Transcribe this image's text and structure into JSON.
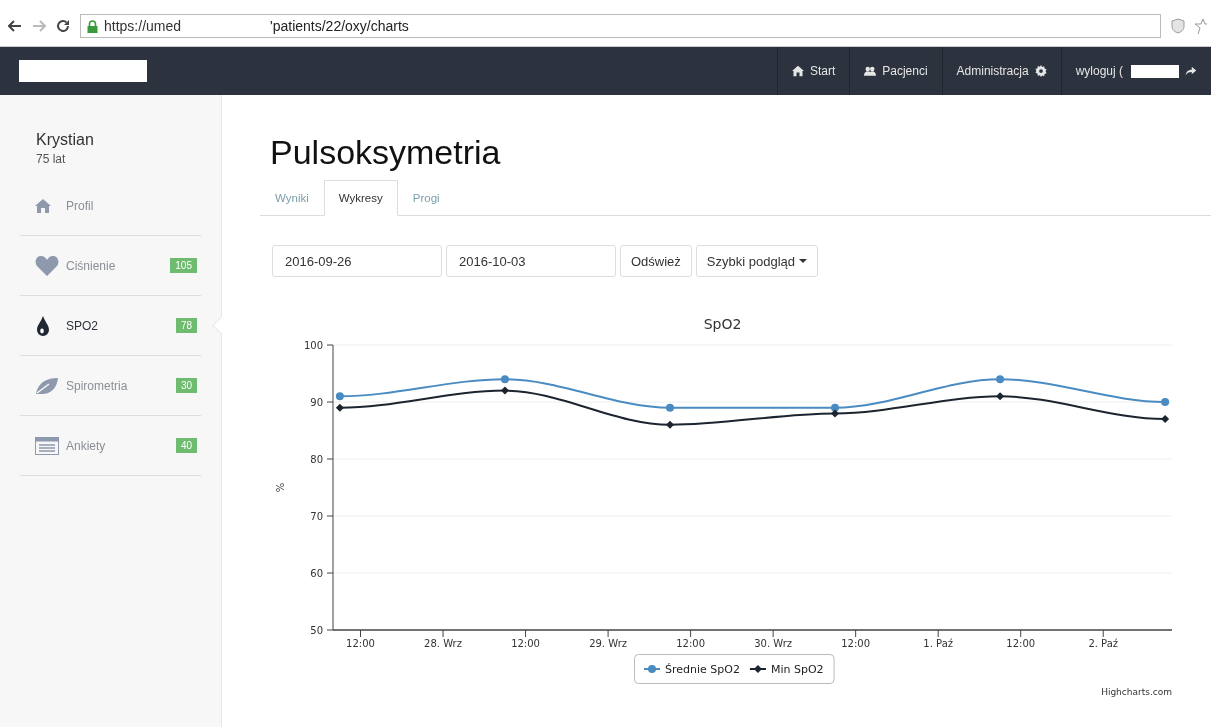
{
  "browser": {
    "url_parts": [
      "https://umed",
      "'patients/22/oxy/charts"
    ]
  },
  "navbar": {
    "items": [
      {
        "label": "Start"
      },
      {
        "label": "Pacjenci"
      },
      {
        "label": "Administracja"
      },
      {
        "label": "wyloguj ("
      }
    ]
  },
  "sidebar": {
    "patient_name": "Krystian",
    "age": "75 lat",
    "items": [
      {
        "label": "Profil",
        "selected": false
      },
      {
        "label": "Ciśnienie",
        "badge": "105",
        "selected": false
      },
      {
        "label": "SPO2",
        "badge": "78",
        "selected": true
      },
      {
        "label": "Spirometria",
        "badge": "30",
        "selected": false
      },
      {
        "label": "Ankiety",
        "badge": "40",
        "selected": false
      }
    ]
  },
  "page": {
    "title": "Pulsoksymetria",
    "tabs": [
      {
        "label": "Wyniki",
        "selected": false
      },
      {
        "label": "Wykresy",
        "selected": true
      },
      {
        "label": "Progi",
        "selected": false
      }
    ],
    "date_from": "2016-09-26",
    "date_to": "2016-10-03",
    "refresh_button": "Odśwież",
    "quick_view_button": "Szybki podgląd"
  },
  "chart": {
    "credit": "Highcharts.com",
    "chart_data": {
      "type": "line",
      "title": "SpO2",
      "ylabel": "%",
      "categories": [
        null,
        "12:00",
        null,
        null,
        null,
        "28. Wrz",
        null,
        null,
        null,
        "12:00",
        null,
        null,
        null,
        "29. Wrz",
        null,
        null,
        null,
        "12:00",
        null,
        null,
        null,
        "30. Wrz",
        null,
        null,
        null,
        "12:00",
        null,
        null,
        null,
        "1. Paź",
        null,
        null,
        null,
        "12:00",
        null,
        null,
        null,
        "2. Paź",
        null,
        null,
        null
      ],
      "ylim": [
        50,
        100
      ],
      "grid": true,
      "legend": "bottom",
      "yticks": [
        50,
        60,
        70,
        80,
        90,
        100
      ],
      "series": [
        {
          "name": "Średnie SpO2",
          "color": "#4a8bc2",
          "marker": "circle",
          "values": [
            91,
            null,
            null,
            null,
            null,
            null,
            null,
            null,
            94,
            null,
            null,
            null,
            null,
            null,
            null,
            null,
            89,
            null,
            null,
            null,
            null,
            null,
            null,
            null,
            89,
            null,
            null,
            null,
            null,
            null,
            null,
            null,
            94,
            null,
            null,
            null,
            null,
            null,
            null,
            null,
            90
          ]
        },
        {
          "name": "Min SpO2",
          "color": "#1c2430",
          "marker": "diamond",
          "values": [
            89,
            null,
            null,
            null,
            null,
            null,
            null,
            null,
            92,
            null,
            null,
            null,
            null,
            null,
            null,
            null,
            86,
            null,
            null,
            null,
            null,
            null,
            null,
            null,
            88,
            null,
            null,
            null,
            null,
            null,
            null,
            null,
            91,
            null,
            null,
            null,
            null,
            null,
            null,
            null,
            87
          ]
        }
      ]
    }
  }
}
